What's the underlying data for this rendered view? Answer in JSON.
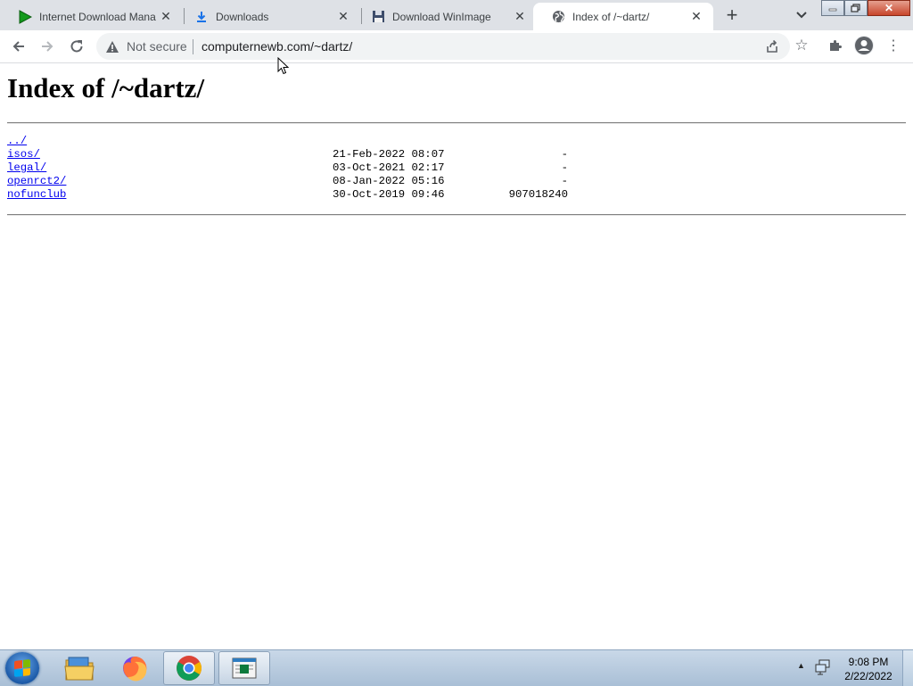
{
  "tabs": [
    {
      "title": "Internet Download Mana",
      "icon": "play-triangle-icon",
      "active": false
    },
    {
      "title": "Downloads",
      "icon": "download-arrow-icon",
      "active": false
    },
    {
      "title": "Download WinImage",
      "icon": "floppy-disk-icon",
      "active": false
    },
    {
      "title": "Index of /~dartz/",
      "icon": "globe-icon",
      "active": true
    }
  ],
  "omnibox": {
    "security_label": "Not secure",
    "url": "computernewb.com/~dartz/"
  },
  "page": {
    "heading": "Index of /~dartz/",
    "parent_link": "../",
    "entries": [
      {
        "name": "isos/",
        "date": "21-Feb-2022 08:07",
        "size": "-"
      },
      {
        "name": "legal/",
        "date": "03-Oct-2021 02:17",
        "size": "-"
      },
      {
        "name": "openrct2/",
        "date": "08-Jan-2022 05:16",
        "size": "-"
      },
      {
        "name": "nofunclub",
        "date": "30-Oct-2019 09:46",
        "size": "907018240"
      }
    ]
  },
  "taskbar": {
    "apps": [
      "windows-explorer",
      "firefox",
      "google-chrome",
      "notepad"
    ],
    "time": "9:08 PM",
    "date": "2/22/2022"
  },
  "colors": {
    "tabstrip_bg": "#dee1e6",
    "link": "#0000ee",
    "taskbar_bg": "#b9cde0"
  }
}
